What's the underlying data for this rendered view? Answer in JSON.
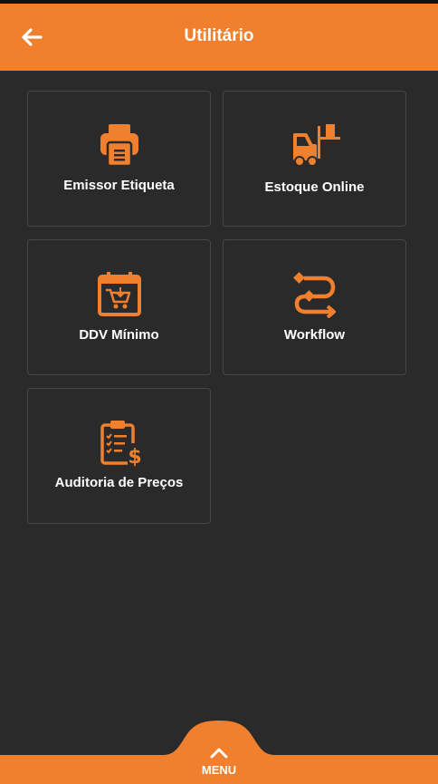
{
  "header": {
    "title": "Utilitário",
    "back_icon": "arrow-left-icon",
    "background": "#f0802e"
  },
  "tiles": [
    {
      "label": "Emissor Etiqueta",
      "icon": "printer-icon"
    },
    {
      "label": "Estoque Online",
      "icon": "forklift-icon"
    },
    {
      "label": "DDV Mínimo",
      "icon": "calendar-cart-icon"
    },
    {
      "label": "Workflow",
      "icon": "workflow-route-icon"
    },
    {
      "label": "Auditoria de Preços",
      "icon": "clipboard-price-icon"
    }
  ],
  "menu": {
    "label": "MENU",
    "icon": "chevron-up-icon"
  },
  "colors": {
    "accent": "#f0802e",
    "background": "#2a2a2a",
    "card_border": "#474747",
    "text": "#ffffff"
  }
}
